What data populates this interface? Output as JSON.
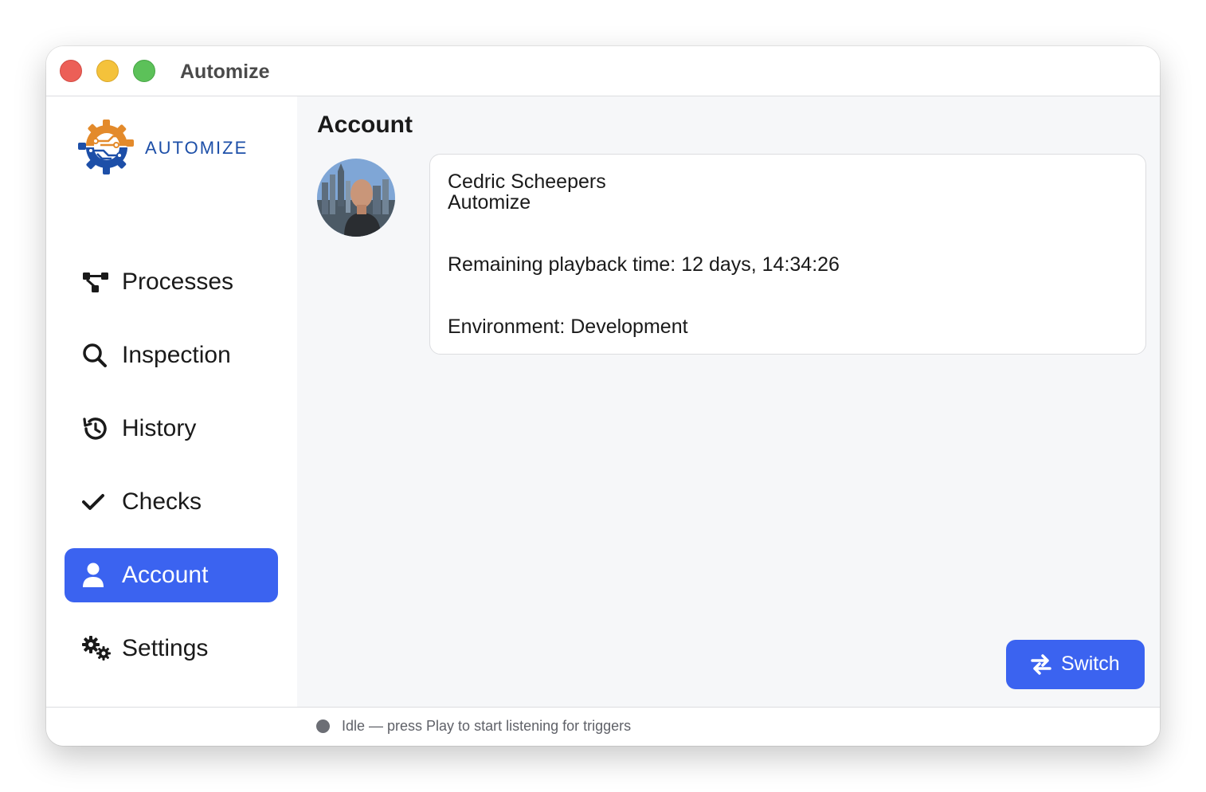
{
  "window": {
    "title": "Automize"
  },
  "sidebar": {
    "logo_text": "AUTOMIZE",
    "items": [
      {
        "label": "Processes",
        "icon": "flow-icon",
        "active": false
      },
      {
        "label": "Inspection",
        "icon": "search-icon",
        "active": false
      },
      {
        "label": "History",
        "icon": "history-icon",
        "active": false
      },
      {
        "label": "Checks",
        "icon": "checkmark-icon",
        "active": false
      },
      {
        "label": "Account",
        "icon": "user-icon",
        "active": true
      },
      {
        "label": "Settings",
        "icon": "gears-icon",
        "active": false
      }
    ]
  },
  "main": {
    "title": "Account",
    "account": {
      "name": "Cedric Scheepers",
      "organization": "Automize",
      "playback_time": "Remaining playback time: 12 days, 14:34:26",
      "environment": "Environment: Development"
    },
    "switch_button_label": "Switch"
  },
  "status": {
    "text": "Idle — press Play to start listening for triggers"
  },
  "colors": {
    "accent": "#3b63f0",
    "logo_blue": "#1d4fa8",
    "logo_orange": "#e38a2b",
    "status_dot": "#6c6e75"
  }
}
